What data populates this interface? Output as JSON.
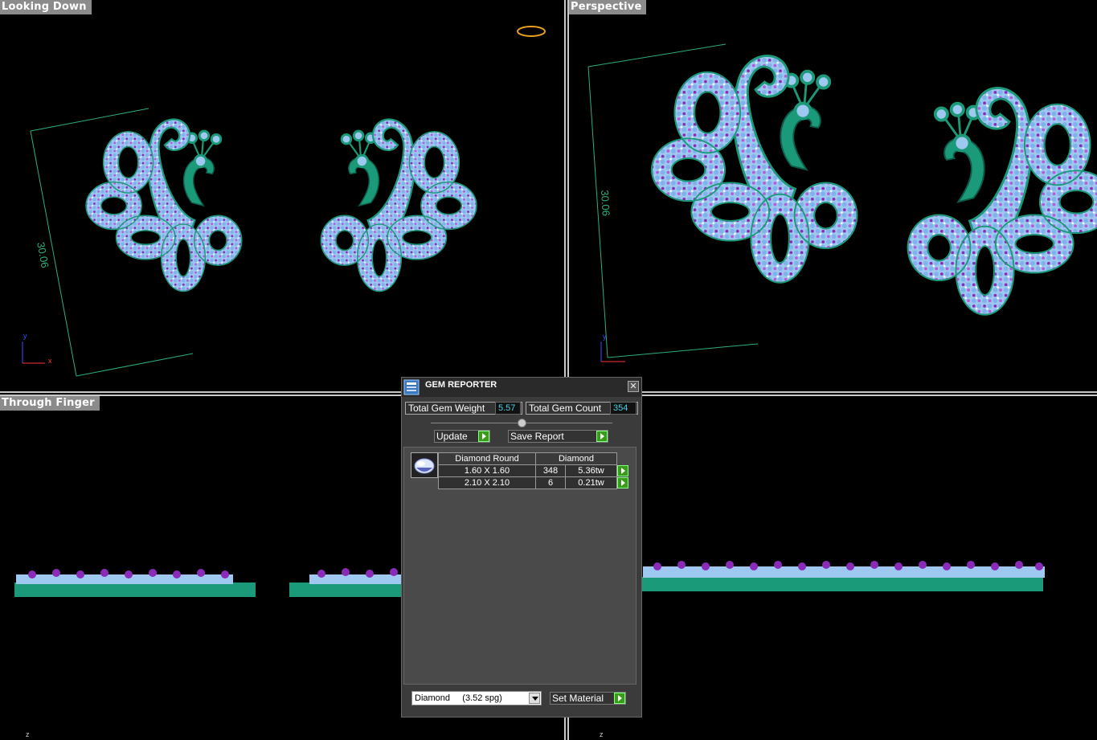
{
  "viewports": {
    "top_left": {
      "label": "Looking Down",
      "dimension": "30.06",
      "axes": [
        "y",
        "x"
      ]
    },
    "top_right": {
      "label": "Perspective",
      "dimension": "30.06",
      "axes": [
        "y"
      ]
    },
    "bottom_left": {
      "label": "Through Finger",
      "axes": [
        "z"
      ]
    },
    "bottom_right": {
      "axes": [
        "z"
      ]
    }
  },
  "gem_reporter": {
    "title": "GEM REPORTER",
    "close_label": "✕",
    "total_weight_label": "Total Gem Weight",
    "total_weight_value": "5.57",
    "total_count_label": "Total Gem Count",
    "total_count_value": "354",
    "update_label": "Update",
    "save_report_label": "Save Report",
    "table": {
      "shape_header": "Diamond Round",
      "material_header": "Diamond",
      "rows": [
        {
          "size": "1.60 X 1.60",
          "count": "348",
          "weight": "5.36tw"
        },
        {
          "size": "2.10 X 2.10",
          "count": "6",
          "weight": "0.21tw"
        }
      ]
    },
    "material_select": "Diamond     (3.52 spg)",
    "set_material_label": "Set Material"
  },
  "colors": {
    "metal": "#1a9a78",
    "gem_fill": "#9ec8f0",
    "gem_accent": "#8a2ab8",
    "dimension_line": "#2fae7a"
  }
}
